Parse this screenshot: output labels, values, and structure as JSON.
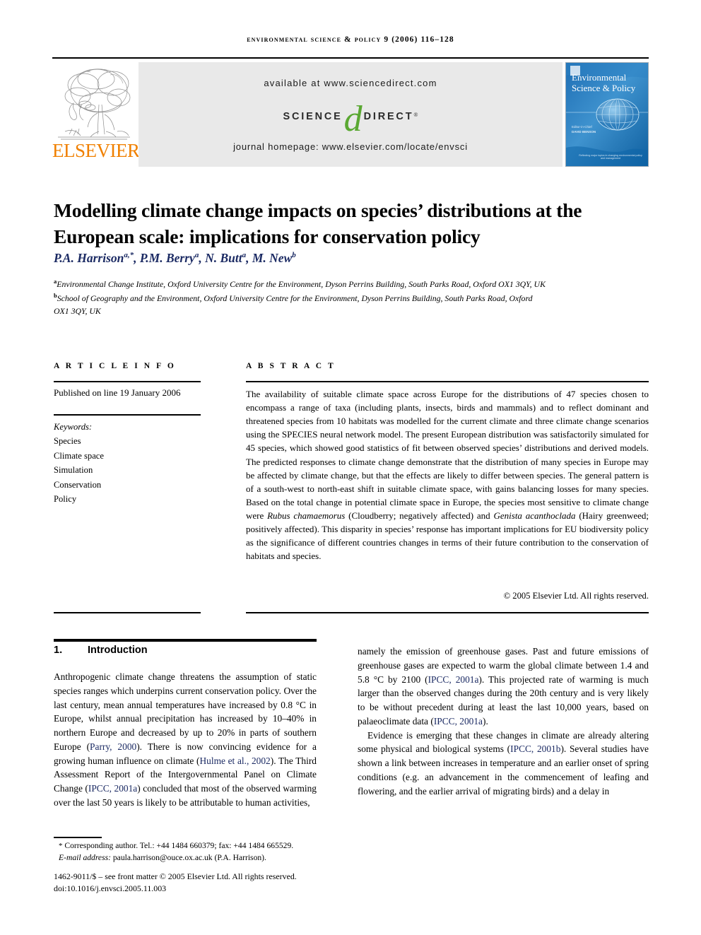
{
  "running_head": "Environmental Science & Policy 9 (2006) 116–128",
  "masthead": {
    "publisher_name": "ELSEVIER",
    "available_at": "available at www.sciencedirect.com",
    "sciencedirect_science": "SCIENCE",
    "sciencedirect_d": "d",
    "sciencedirect_direct": "DIRECT",
    "registered_mark": "®",
    "journal_homepage": "journal homepage: www.elsevier.com/locate/envsci",
    "cover_title": "Environmental Science & Policy",
    "cover_editor_label": "Editor-in-Chief",
    "cover_editor_name": "DAVID BENSON",
    "cover_footer": "Reflecting major topics in changing environmental policy and management"
  },
  "article": {
    "title": "Modelling climate change impacts on species’ distributions at the European scale: implications for conservation policy",
    "authors": "P.A. Harrison, P.M. Berry, N. Butt, M. New",
    "author_list": [
      {
        "name": "P.A. Harrison",
        "sup": "a,*"
      },
      {
        "name": "P.M. Berry",
        "sup": "a"
      },
      {
        "name": "N. Butt",
        "sup": "a"
      },
      {
        "name": "M. New",
        "sup": "b"
      }
    ],
    "affiliations": [
      {
        "marker": "a",
        "text": "Environmental Change Institute, Oxford University Centre for the Environment, Dyson Perrins Building, South Parks Road, Oxford OX1 3QY, UK"
      },
      {
        "marker": "b",
        "text": "School of Geography and the Environment, Oxford University Centre for the Environment, Dyson Perrins Building, South Parks Road, Oxford OX1 3QY, UK"
      }
    ]
  },
  "article_info": {
    "heading": "A R T I C L E   I N F O",
    "published": "Published on line 19 January 2006",
    "keywords_label": "Keywords:",
    "keywords": [
      "Species",
      "Climate space",
      "Simulation",
      "Conservation",
      "Policy"
    ]
  },
  "abstract": {
    "heading": "A B S T R A C T",
    "paragraph_1": "The availability of suitable climate space across Europe for the distributions of 47 species chosen to encompass a range of taxa (including plants, insects, birds and mammals) and to reflect dominant and threatened species from 10 habitats was modelled for the current climate and three climate change scenarios using the SPECIES neural network model. The present European distribution was satisfactorily simulated for 45 species, which showed good statistics of fit between observed species’ distributions and derived models. The predicted responses to climate change demonstrate that the distribution of many species in Europe may be affected by climate change, but that the effects are likely to differ between species. The general pattern is of a south-west to north-east shift in suitable climate space, with gains balancing losses for many species. Based on the total change in potential climate space in Europe, the species most sensitive to climate change were ",
    "species_1": "Rubus chamaemorus",
    "paragraph_2": " (Cloudberry; negatively affected) and ",
    "species_2": "Genista acanthoclada",
    "paragraph_3": " (Hairy greenweed; positively affected). This disparity in species’ response has important implications for EU biodiversity policy as the significance of different countries changes in terms of their future contribution to the conservation of habitats and species.",
    "copyright": "© 2005 Elsevier Ltd. All rights reserved."
  },
  "introduction": {
    "number": "1.",
    "heading": "Introduction",
    "left_col_text_a": "Anthropogenic climate change threatens the assumption of static species ranges which underpins current conservation policy. Over the last century, mean annual temperatures have increased by 0.8 °C in Europe, whilst annual precipitation has increased by 10–40% in northern Europe and decreased by up to 20% in parts of southern Europe (",
    "cite_parry": "Parry, 2000",
    "left_col_text_b": "). There is now convincing evidence for a growing human influence on climate (",
    "cite_hulme": "Hulme et al., 2002",
    "left_col_text_c": "). The Third Assessment Report of the Intergovernmental Panel on Climate Change (",
    "cite_ipcc_2001a_1": "IPCC, 2001a",
    "left_col_text_d": ") concluded that most of the observed warming over the last 50 years is likely to be attributable to human activities,",
    "right_col_text_a": "namely the emission of greenhouse gases. Past and future emissions of greenhouse gases are expected to warm the global climate between 1.4 and 5.8 °C by 2100 (",
    "cite_ipcc_2001a_2": "IPCC, 2001a",
    "right_col_text_b": "). This projected rate of warming is much larger than the observed changes during the 20th century and is very likely to be without precedent during at least the last 10,000 years, based on palaeoclimate data (",
    "cite_ipcc_2001a_3": "IPCC, 2001a",
    "right_col_text_c": ").",
    "right_col_text_d": "Evidence is emerging that these changes in climate are already altering some physical and biological systems (",
    "cite_ipcc_2001b": "IPCC, 2001b",
    "right_col_text_e": "). Several studies have shown a link between increases in temperature and an earlier onset of spring conditions (e.g. an advancement in the commencement of leafing and flowering, and the earlier arrival of migrating birds) and a delay in"
  },
  "footer": {
    "corresponding_star": "*",
    "corresponding_text": "Corresponding author. Tel.: +44 1484 660379; fax: +44 1484 665529.",
    "email_label": "E-mail address:",
    "email_value": "paula.harrison@ouce.ox.ac.uk (P.A. Harrison).",
    "issn_line": "1462-9011/$ – see front matter © 2005 Elsevier Ltd. All rights reserved.",
    "doi_line": "doi:10.1016/j.envsci.2005.11.003"
  },
  "colors": {
    "accent_orange": "#F08000",
    "sciencedirect_green": "#5AA832",
    "citation_blue": "#1B2A63",
    "band_grey": "#E9E9E9",
    "cover_blue": "#2F7FC1"
  }
}
